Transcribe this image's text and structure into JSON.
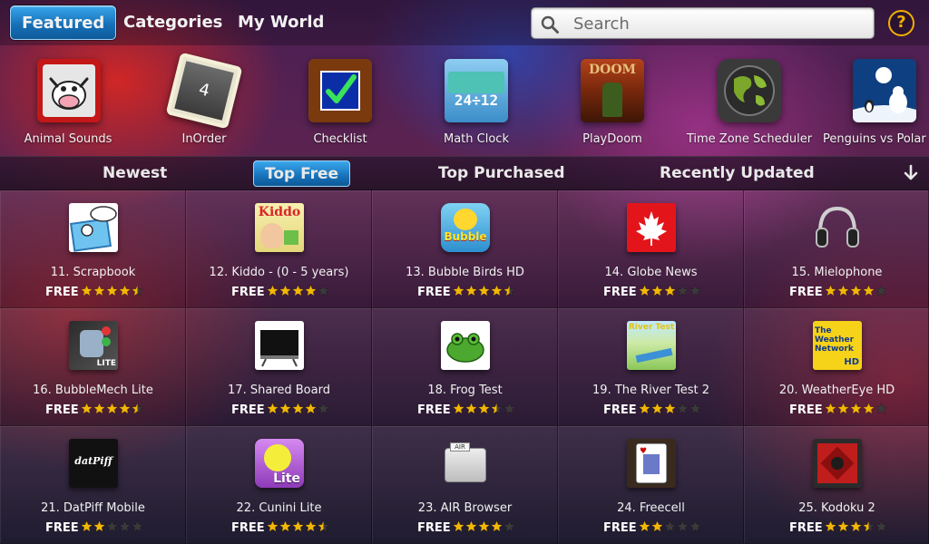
{
  "nav": {
    "tabs": [
      {
        "label": "Featured",
        "active": true
      },
      {
        "label": "Categories",
        "active": false
      },
      {
        "label": "My World",
        "active": false
      }
    ]
  },
  "search": {
    "placeholder": "Search",
    "value": ""
  },
  "help": {
    "label": "?"
  },
  "colors": {
    "accent_blue": "#1a78c2",
    "star_gold": "#f2b705",
    "star_empty": "#3a3a3a",
    "help_gold": "#f0b000"
  },
  "featured": [
    {
      "label": "Animal Sounds",
      "icon": "animal-sounds-icon"
    },
    {
      "label": "InOrder",
      "icon": "inorder-icon"
    },
    {
      "label": "Checklist",
      "icon": "checklist-icon"
    },
    {
      "label": "Math Clock",
      "icon": "math-clock-icon"
    },
    {
      "label": "PlayDoom",
      "icon": "playdoom-icon"
    },
    {
      "label": "Time Zone Scheduler",
      "icon": "globe-icon"
    },
    {
      "label": "Penguins vs Polar B",
      "icon": "penguins-icon"
    }
  ],
  "featured_icon_text": {
    "inorder": "4",
    "math_clock": "24÷12",
    "playdoom": "DOOM"
  },
  "tabs": [
    {
      "label": "Newest",
      "active": false
    },
    {
      "label": "Top Free",
      "active": true
    },
    {
      "label": "Top Purchased",
      "active": false
    },
    {
      "label": "Recently Updated",
      "active": false
    }
  ],
  "apps": [
    {
      "name": "11. Scrapbook",
      "price": "FREE",
      "rating": 4.5,
      "icon": "scrapbook-icon"
    },
    {
      "name": "12. Kiddo - (0 - 5 years)",
      "price": "FREE",
      "rating": 4,
      "icon": "kiddo-icon"
    },
    {
      "name": "13. Bubble Birds HD",
      "price": "FREE",
      "rating": 4.5,
      "icon": "bubble-birds-icon"
    },
    {
      "name": "14. Globe News",
      "price": "FREE",
      "rating": 3,
      "icon": "maple-leaf-icon"
    },
    {
      "name": "15. Mielophone",
      "price": "FREE",
      "rating": 4,
      "icon": "headphones-icon"
    },
    {
      "name": "16. BubbleMech Lite",
      "price": "FREE",
      "rating": 4.5,
      "icon": "bubblemech-icon"
    },
    {
      "name": "17. Shared Board",
      "price": "FREE",
      "rating": 4,
      "icon": "whiteboard-icon"
    },
    {
      "name": "18. Frog Test",
      "price": "FREE",
      "rating": 3.5,
      "icon": "frog-icon"
    },
    {
      "name": "19. The River Test 2",
      "price": "FREE",
      "rating": 3,
      "icon": "river-test-icon"
    },
    {
      "name": "20. WeatherEye HD",
      "price": "FREE",
      "rating": 4,
      "icon": "weather-network-icon"
    },
    {
      "name": "21. DatPiff Mobile",
      "price": "FREE",
      "rating": 2,
      "icon": "datpiff-icon"
    },
    {
      "name": "22. Cunini Lite",
      "price": "FREE",
      "rating": 4.5,
      "icon": "cunini-icon"
    },
    {
      "name": "23. AIR Browser",
      "price": "FREE",
      "rating": 4,
      "icon": "folder-icon"
    },
    {
      "name": "24. Freecell",
      "price": "FREE",
      "rating": 2,
      "icon": "playing-card-icon"
    },
    {
      "name": "25. Kodoku 2",
      "price": "FREE",
      "rating": 3.5,
      "icon": "kodoku-icon"
    }
  ],
  "app_icon_text": {
    "kiddo": "Kiddo",
    "bubble": "Bubble",
    "bubblemech": "LITE",
    "river": "River Test",
    "weather": "The Weather Network",
    "weather_hd": "HD",
    "datpiff": "datPiff",
    "cunini": "Lite",
    "air": "AIR"
  }
}
